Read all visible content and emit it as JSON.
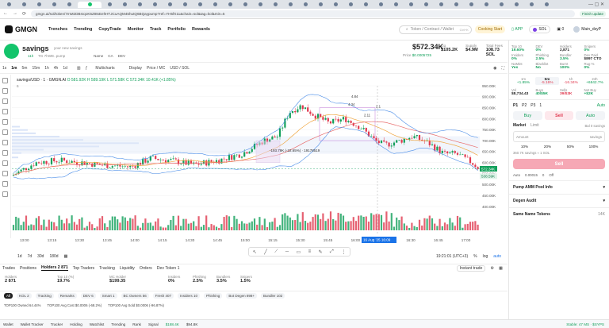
{
  "browser": {
    "url": "gmgn.ai/sol/token/7mM2DBsrqoK5Z8tsEehHTJCuAQM45hutQ6BQaypump?ref=YH5fX11&chain=sol&tag=kol&min=5",
    "ext_toolbar_label": "Finish update"
  },
  "nav": {
    "logo": "GMGN",
    "menu": [
      "Trenches",
      "Trending",
      "CopyTrade",
      "Monitor",
      "Track",
      "Portfolio",
      "Rewards"
    ],
    "search_placeholder": "Token / Contract / Wallet",
    "search_shortcut": "Ctrl+K",
    "cooking": "Cooking",
    "cooking_sub": "Start",
    "app": "APP",
    "chain": "SOL",
    "wallet_balance": "0",
    "wallet_name": "Main_dsyP"
  },
  "token": {
    "name": "savings",
    "desc": "your new savings",
    "age": "11h",
    "meta": "TG 7hWE..pump",
    "links": [
      "Name",
      "CA",
      "DEV"
    ],
    "price_big": "$572.34K",
    "price_label": "Price",
    "price_value": "$0.0005725",
    "stats": [
      {
        "label": "Liq",
        "value": "$105.2K"
      },
      {
        "label": "Supply",
        "value": "$4.9M"
      },
      {
        "label": "Total Fees",
        "value": "108.73 SOL"
      }
    ]
  },
  "toolbar": {
    "intervals": [
      "1s",
      "1m",
      "5m",
      "15m",
      "1h",
      "4h",
      "1d"
    ],
    "active_interval": "1m",
    "multicharts": "Multicharts",
    "display": "Display",
    "price_mc": "Price / MC",
    "usd_sol": "USD / SOL"
  },
  "chart_legend": {
    "symbol": "savings/USD · 1 · GMGN.AI",
    "o": "O 581.92K",
    "h": "H 589.19K",
    "l": "L 571.58K",
    "c": "C 572.34K",
    "chg": "10.41K (+1.85%)",
    "volume": "6"
  },
  "chart_data": {
    "type": "candlestick",
    "y_ticks": [
      "950.00K",
      "900.00K",
      "850.00K",
      "800.00K",
      "750.00K",
      "700.00K",
      "650.00K",
      "600.00K",
      "550.00K",
      "500.00K",
      "450.00K",
      "400.00K"
    ],
    "x_ticks": [
      "13:00",
      "13:15",
      "13:30",
      "13:45",
      "14:00",
      "14:15",
      "14:30",
      "14:45",
      "15:00",
      "15:15",
      "15:30",
      "15:45",
      "16:00",
      "16:15",
      "16:30",
      "16:45",
      "17:00"
    ],
    "current_price_tag": "572.34K",
    "bid_tag": "538.59K",
    "annotations": [
      "4.84",
      "4.34",
      "2.11",
      "2.1"
    ],
    "measure_label": "-193.79K (-22.65%) · 19178519",
    "hover_date": "16 Aug '25",
    "hover_time": "16:09"
  },
  "chart_footer": {
    "ranges": [
      "1d",
      "7d",
      "30d",
      "180d"
    ],
    "time": "19:21:01 (UTC+3)",
    "pct": "%",
    "log": "log",
    "auto": "auto"
  },
  "bottom_tabs": [
    "Trades",
    "Positions",
    "Holders 2 871",
    "Top Traders",
    "Tracking",
    "Liquidity",
    "Orders",
    "Dev Token 1"
  ],
  "instant_trade": "Instant trade",
  "holders_stats": [
    {
      "label": "Holders",
      "value": "2 871"
    },
    {
      "label": "Top 10 (%)",
      "value": "19.7%"
    },
    {
      "label": "MC Holder",
      "value": "$199.35"
    },
    {
      "label": "Insiders",
      "value": "0%"
    },
    {
      "label": "Phishing",
      "value": "2.5%"
    },
    {
      "label": "Bundlers",
      "value": "3.5%"
    },
    {
      "label": "Snipers",
      "value": "1.5%"
    }
  ],
  "filters": [
    "All",
    "KOL 2",
    "Tracking",
    "Remarks",
    "DEV 6",
    "Smart 1",
    "BC Owners 56",
    "Fresh 407",
    "Insiders 10",
    "Phishing",
    "Bot Degen 898+",
    "Bundler 102"
  ],
  "top_owned": [
    "TOP100 Owned 64.44%",
    "TOP100 Avg Cost $0.0006 (-68.2%)",
    "TOP100 Avg Sold $0.0006 (-96.87%)"
  ],
  "footer": {
    "items": [
      "Wallet",
      "Wallet Tracker",
      "Tracker",
      "Holding",
      "Watchlist",
      "Trending",
      "Rank",
      "Signal",
      "$188.4K",
      "$94.8K"
    ],
    "status": "Stable: 47 MS · $SYPS"
  },
  "right": {
    "audit": [
      {
        "label": "Top 10",
        "value": "19.60%"
      },
      {
        "label": "DEV",
        "value": "0%"
      },
      {
        "label": "Holders",
        "value": "2,871"
      },
      {
        "label": "Snipers",
        "value": "0%"
      },
      {
        "label": "Insiders",
        "value": "0%"
      },
      {
        "label": "Phishing",
        "value": "2.5%"
      },
      {
        "label": "Bundler",
        "value": "3.5%"
      },
      {
        "label": "Dev Paid",
        "value": "$897 CTO"
      },
      {
        "label": "NoMint",
        "value": "Yes"
      },
      {
        "label": "Blacklist",
        "value": "No"
      },
      {
        "label": "Burnt",
        "value": "100%"
      },
      {
        "label": "Rug %",
        "value": "0%"
      }
    ],
    "periods": [
      {
        "label": "1m",
        "value": "+1.85%"
      },
      {
        "label": "5m",
        "value": "-5.16%"
      },
      {
        "label": "1h",
        "value": "-16.34%"
      },
      {
        "label": "24h",
        "value": "+6842.7%"
      }
    ],
    "vol": [
      {
        "label": "Vol",
        "value": "$8,734.43"
      },
      {
        "label": "Buys",
        "value": "40/$5K"
      },
      {
        "label": "Sells",
        "value": "39/$3K"
      },
      {
        "label": "Net Buy",
        "value": "+$2K"
      }
    ],
    "presets": [
      "P1",
      "P2",
      "P3"
    ],
    "preset_count": "1",
    "auto": "Auto",
    "buy": "Buy",
    "sell": "Sell",
    "market": "Market",
    "limit": "Limit",
    "limit_sub": "Bal 0 savings",
    "amount_label": "Amount",
    "amount_unit": "savings",
    "pcts": [
      "10%",
      "20%",
      "50%",
      "100%"
    ],
    "amount_sub": "360.7K savings ≈ 1 SOL",
    "sell_btn": "Sell",
    "auto2": "Auto",
    "fee": "0.00015",
    "slip": "0",
    "mev": "Off",
    "pool_info": "Pump AMM Pool Info",
    "degen_audit": "Degen Audit",
    "same_name": "Same Name Tokens",
    "same_name_count": "14K"
  }
}
